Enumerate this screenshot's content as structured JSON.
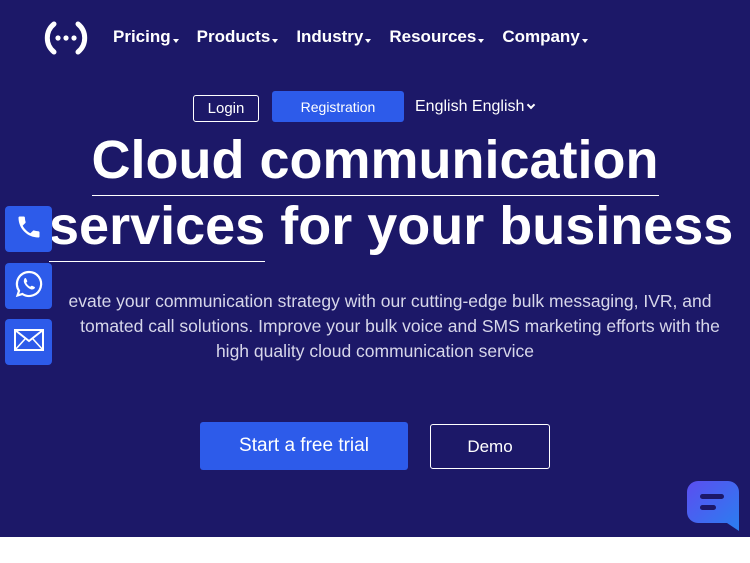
{
  "nav": {
    "items": [
      {
        "label": "Pricing"
      },
      {
        "label": "Products"
      },
      {
        "label": "Industry"
      },
      {
        "label": "Resources"
      },
      {
        "label": "Company"
      }
    ]
  },
  "auth": {
    "login_label": "Login",
    "registration_label": "Registration",
    "language_label": "English English"
  },
  "hero": {
    "title_line1": "Cloud communication",
    "title_line2_underlined": "services",
    "title_line2_rest": " for your business",
    "description_line1": "evate your communication strategy with our cutting-edge bulk messaging, IVR, and",
    "description_line2": "tomated call solutions. Improve your bulk voice and SMS marketing efforts with the",
    "description_line3": "high quality cloud communication service",
    "cta_primary": "Start a free trial",
    "cta_secondary": "Demo"
  },
  "colors": {
    "hero_bg": "#1c1868",
    "accent": "#2d5bea",
    "text": "#ffffff",
    "muted_text": "#d7d7ea"
  },
  "icons": {
    "logo": "signal-broadcast-icon",
    "phone": "phone-icon",
    "whatsapp": "whatsapp-icon",
    "mail": "mail-icon",
    "chat": "chat-bubble-icon"
  }
}
